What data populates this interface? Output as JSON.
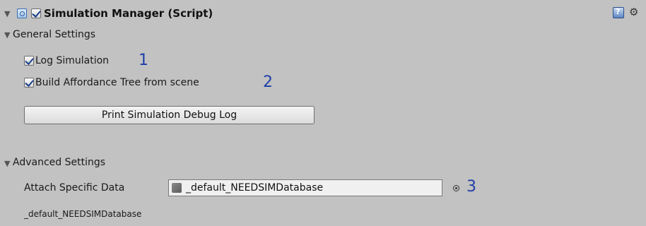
{
  "component": {
    "title": "Simulation Manager (Script)",
    "enabled": true
  },
  "general_settings": {
    "label": "General Settings",
    "log_simulation": {
      "label": "Log Simulation",
      "checked": true,
      "annotation": "1"
    },
    "build_affordance": {
      "label": "Build Affordance Tree from scene",
      "checked": true,
      "annotation": "2"
    },
    "print_button_label": "Print Simulation Debug Log"
  },
  "advanced_settings": {
    "label": "Advanced Settings",
    "attach_label": "Attach Specific Data",
    "attach_value": "_default_NEEDSIMDatabase",
    "annotation": "3",
    "footer_text": "_default_NEEDSIMDatabase"
  },
  "icons": {
    "fold": "triangle-down-icon",
    "script": "script-icon",
    "help": "help-icon",
    "settings": "gear-icon",
    "asset": "asset-icon",
    "picker": "object-picker-icon"
  }
}
